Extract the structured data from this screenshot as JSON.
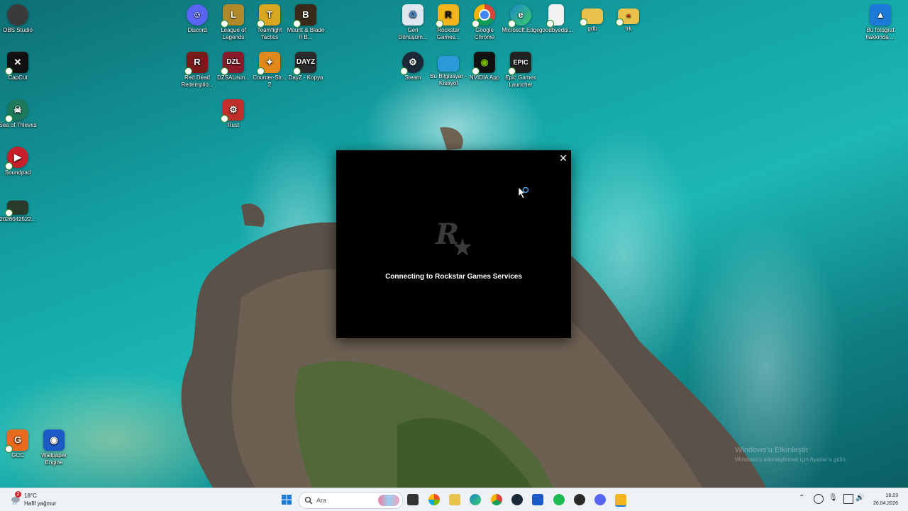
{
  "desktop": {
    "icons_left": [
      {
        "label": "OBS Studio",
        "color": "#3a3a3a"
      },
      {
        "label": "CapCut",
        "color": "#111111"
      },
      {
        "label": "Sea of Thieves",
        "color": "#1c7a5a"
      },
      {
        "label": "Soundpad",
        "color": "#c8202a"
      },
      {
        "label": "2026042522...",
        "color": "#2a3a2a"
      },
      {
        "label": "GCC",
        "color": "#e86a1c"
      },
      {
        "label": "Wallpaper Engine",
        "color": "#1c5ac8"
      }
    ],
    "icons_top": [
      {
        "label": "Discord",
        "color": "#5865f2"
      },
      {
        "label": "League of Legends",
        "color": "#b08a2a"
      },
      {
        "label": "Teamfight Tactics",
        "color": "#d9a820"
      },
      {
        "label": "Mount & Blade II B...",
        "color": "#3a2a1a"
      },
      {
        "label": "Red Dead Redemptio...",
        "color": "#7a1a1a"
      },
      {
        "label": "DZSALaun...",
        "color": "#8a1a2a"
      },
      {
        "label": "Counter-Str... 2",
        "color": "#e08a1c"
      },
      {
        "label": "DayZ - Kopya",
        "color": "#2a2a2a"
      },
      {
        "label": "Rust",
        "color": "#c0302a"
      },
      {
        "label": "Geri Dönüşüm...",
        "color": "#4a8ac8"
      },
      {
        "label": "Rockstar Games...",
        "color": "#f2b51c"
      },
      {
        "label": "Google Chrome",
        "color": "#3a8a3a"
      },
      {
        "label": "Microsoft Edge",
        "color": "#1c8ac8"
      },
      {
        "label": "goodbyedpi...",
        "color": "#e8e8e8"
      },
      {
        "label": "gdb",
        "color": "#e8c24a"
      },
      {
        "label": "trk",
        "color": "#e8c24a"
      },
      {
        "label": "Steam",
        "color": "#1b2838"
      },
      {
        "label": "Bu Bilgisayar - Kısayol",
        "color": "#2a9ad8"
      },
      {
        "label": "NVIDIA App",
        "color": "#76b900"
      },
      {
        "label": "Epic Games Launcher",
        "color": "#222222"
      }
    ],
    "icon_top_right": {
      "label": "Bu fotoğraf hakkında ...",
      "color": "#1c7ad8"
    },
    "watermark_line1": "Windows'u Etkinleştir",
    "watermark_line2": "Windows'u etkinleştirmek için Ayarlar'a gidin."
  },
  "dialog": {
    "message": "Connecting to Rockstar Games Services",
    "close_symbol": "✕"
  },
  "taskbar": {
    "weather": {
      "temp": "18°C",
      "condition": "Hafif yağmur",
      "badge": "2"
    },
    "search_placeholder": "Ara",
    "clock_time": "16:23",
    "clock_date": "26.04.2026"
  }
}
